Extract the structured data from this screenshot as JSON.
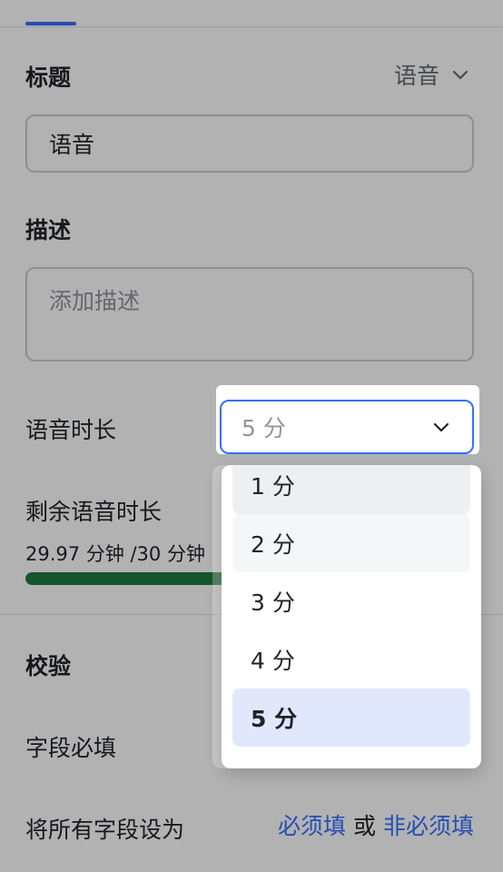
{
  "header": {
    "active_tab_color": "#3370ff"
  },
  "title_section": {
    "label": "标题",
    "field_type": "语音",
    "value": "语音"
  },
  "description_section": {
    "label": "描述",
    "placeholder": "添加描述"
  },
  "duration": {
    "label": "语音时长",
    "selected_value": "5 分"
  },
  "remaining": {
    "label": "剩余语音时长",
    "usage_text": "29.97 分钟 /30 分钟",
    "used_fraction": 0.999
  },
  "validation": {
    "label": "校验",
    "required_label": "字段必填",
    "required_enabled": false,
    "set_all_prefix": "将所有字段设为",
    "set_required_link": "必须填",
    "or_text": "或",
    "set_optional_link": "非必须填"
  },
  "dropdown": {
    "options": [
      {
        "label": "1 分"
      },
      {
        "label": "2 分"
      },
      {
        "label": "3 分"
      },
      {
        "label": "4 分"
      },
      {
        "label": "5 分"
      }
    ],
    "selected_index": 4
  },
  "colors": {
    "accent": "#3370ff",
    "progress": "#1f7a3e",
    "selected_bg": "#e1e8fb"
  }
}
